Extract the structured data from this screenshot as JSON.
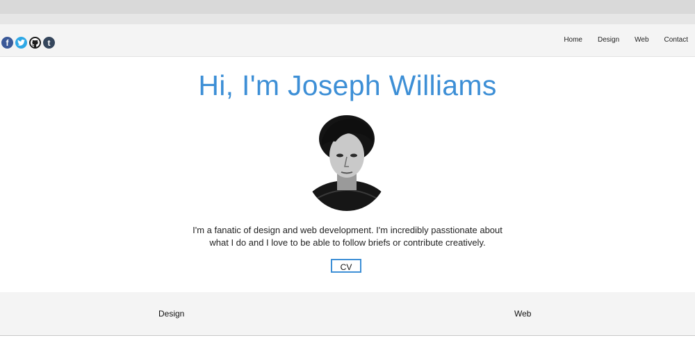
{
  "social": {
    "items": [
      {
        "name": "facebook",
        "glyph": "f",
        "color": "#3b5998"
      },
      {
        "name": "twitter",
        "glyph": "",
        "color": "#2ea8e6"
      },
      {
        "name": "github",
        "glyph": "",
        "color": "#1b1b1b"
      },
      {
        "name": "tumblr",
        "glyph": "t",
        "color": "#35465c"
      }
    ]
  },
  "nav": {
    "home": "Home",
    "design": "Design",
    "web": "Web",
    "contact": "Contact"
  },
  "hero": {
    "title": "Hi, I'm Joseph Williams",
    "bio_line1": "I'm a fanatic of design and web development. I'm incredibly passtionate about",
    "bio_line2": "what I do and I love to be able to follow briefs or contribute creatively.",
    "cv_label": "CV"
  },
  "sections": {
    "design": "Design",
    "web": "Web"
  },
  "colors": {
    "accent": "#3d8fd6",
    "nav_background": "#f4f4f4",
    "browser_chrome": "#d9d9d9"
  }
}
